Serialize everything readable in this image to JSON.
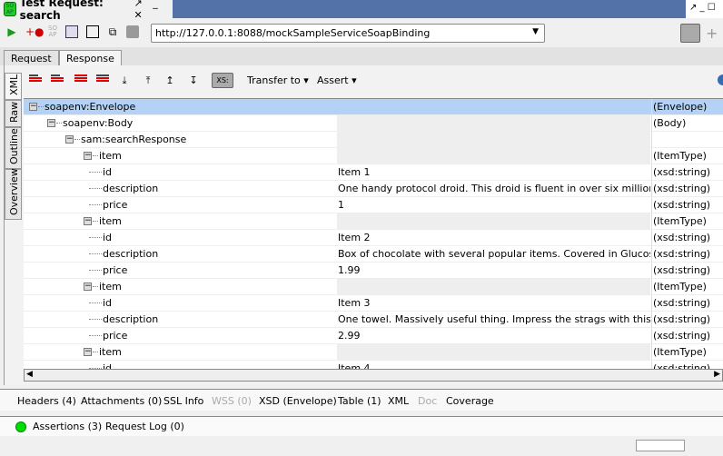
{
  "window": {
    "title": "Test Request: search",
    "logo": "SOAP",
    "controls": "↗ _ ✕",
    "right_controls": "↗ _ ☐"
  },
  "toolbar": {
    "icons": [
      "run-icon",
      "add-assertion-icon",
      "soap-icon",
      "refresh-icon",
      "square-icon",
      "copy-icon",
      "stop-icon"
    ],
    "endpoint": "http://127.0.0.1:8088/mockSampleServiceSoapBinding"
  },
  "tabs": [
    {
      "label": "Request"
    },
    {
      "label": "Response",
      "active": true
    }
  ],
  "side_tabs": [
    {
      "label": "XML"
    },
    {
      "label": "Raw"
    },
    {
      "label": "Outline"
    },
    {
      "label": "Overview"
    }
  ],
  "xml_toolbar": {
    "xs_label": "XS:",
    "transfer_label": "Transfer to",
    "assert_label": "Assert"
  },
  "tree": [
    {
      "name": "soapenv:Envelope",
      "value": "",
      "type": "(Envelope)",
      "depth": 0,
      "expandable": true,
      "selected": true
    },
    {
      "name": "soapenv:Body",
      "value": "",
      "type": "(Body)",
      "depth": 1,
      "expandable": true
    },
    {
      "name": "sam:searchResponse",
      "value": "",
      "type": "",
      "depth": 2,
      "expandable": true
    },
    {
      "name": "item",
      "value": "",
      "type": "(ItemType)",
      "depth": 3,
      "expandable": true
    },
    {
      "name": "id",
      "value": "Item 1",
      "type": "(xsd:string)",
      "depth": 4
    },
    {
      "name": "description",
      "value": "One handy protocol droid. This droid is fluent in over six million forms ...",
      "type": "(xsd:string)",
      "depth": 4
    },
    {
      "name": "price",
      "value": "1",
      "type": "(xsd:string)",
      "depth": 4
    },
    {
      "name": "item",
      "value": "",
      "type": "(ItemType)",
      "depth": 3,
      "expandable": true
    },
    {
      "name": "id",
      "value": "Item 2",
      "type": "(xsd:string)",
      "depth": 4
    },
    {
      "name": "description",
      "value": "Box of chocolate with several popular items. Covered in Glucose.Rec...",
      "type": "(xsd:string)",
      "depth": 4
    },
    {
      "name": "price",
      "value": "1.99",
      "type": "(xsd:string)",
      "depth": 4
    },
    {
      "name": "item",
      "value": "",
      "type": "(ItemType)",
      "depth": 3,
      "expandable": true
    },
    {
      "name": "id",
      "value": "Item 3",
      "type": "(xsd:string)",
      "depth": 4
    },
    {
      "name": "description",
      "value": "One towel. Massively useful thing. Impress the strags with this amazi...",
      "type": "(xsd:string)",
      "depth": 4
    },
    {
      "name": "price",
      "value": "2.99",
      "type": "(xsd:string)",
      "depth": 4
    },
    {
      "name": "item",
      "value": "",
      "type": "(ItemType)",
      "depth": 3,
      "expandable": true
    },
    {
      "name": "id",
      "value": "Item 4",
      "type": "(xsd:string)",
      "depth": 4
    }
  ],
  "bottom_tabs": [
    {
      "label": "Headers (4)"
    },
    {
      "label": "Attachments (0)"
    },
    {
      "label": "SSL Info"
    },
    {
      "label": "WSS (0)",
      "disabled": true
    },
    {
      "label": "XSD (Envelope)"
    },
    {
      "label": "Table (1)"
    },
    {
      "label": "XML"
    },
    {
      "label": "Doc",
      "disabled": true
    },
    {
      "label": "Coverage"
    }
  ],
  "status": {
    "assertions": "Assertions (3)",
    "request_log": "Request Log (0)",
    "assertion_color": "#00dd00"
  }
}
